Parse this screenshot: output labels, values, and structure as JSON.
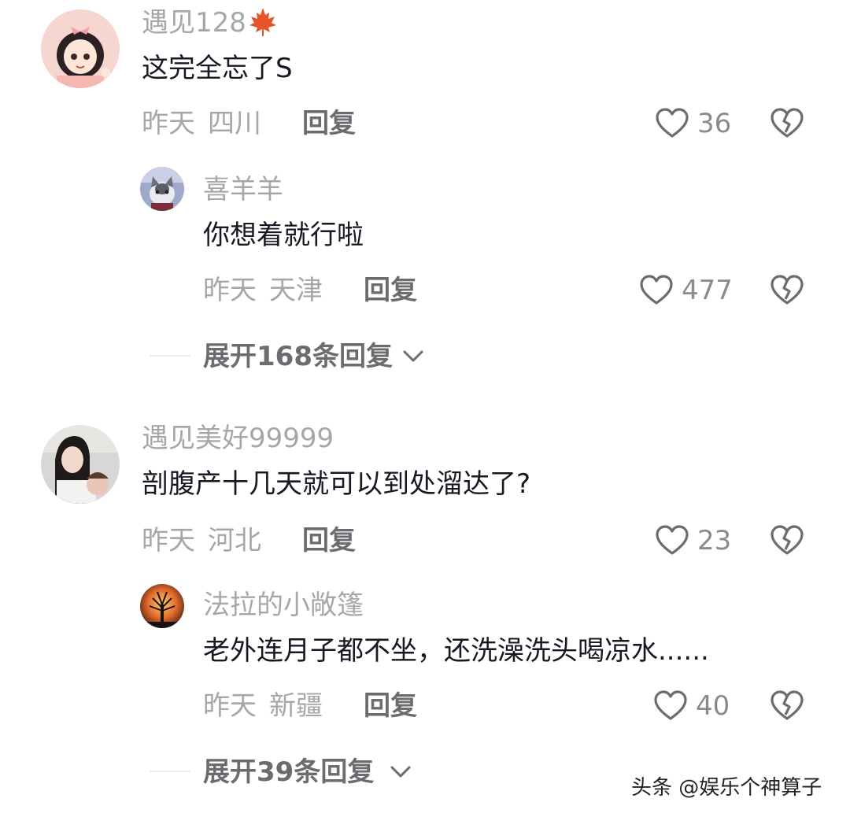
{
  "comments": [
    {
      "username": "遇见128",
      "badge_icon": "maple-leaf-icon",
      "badge_color": "#e8542a",
      "content": "这完全忘了S",
      "time": "昨天",
      "location": "四川",
      "reply_label": "回复",
      "likes": "36",
      "replies": [
        {
          "username": "喜羊羊",
          "content": "你想着就行啦",
          "time": "昨天",
          "location": "天津",
          "reply_label": "回复",
          "likes": "477"
        }
      ],
      "expand_label": "展开168条回复"
    },
    {
      "username": "遇见美好99999",
      "content": "剖腹产十几天就可以到处溜达了?",
      "time": "昨天",
      "location": "河北",
      "reply_label": "回复",
      "likes": "23",
      "replies": [
        {
          "username": "法拉的小敞篷",
          "content": "老外连月子都不坐，还洗澡洗头喝凉水......",
          "time": "昨天",
          "location": "新疆",
          "reply_label": "回复",
          "likes": "40"
        }
      ],
      "expand_label": "展开39条回复"
    }
  ],
  "watermark": "头条 @娱乐个神算子",
  "colors": {
    "primary_text": "#161823",
    "secondary_text": "#a6a7ab",
    "reply_label": "#6b6c70"
  }
}
